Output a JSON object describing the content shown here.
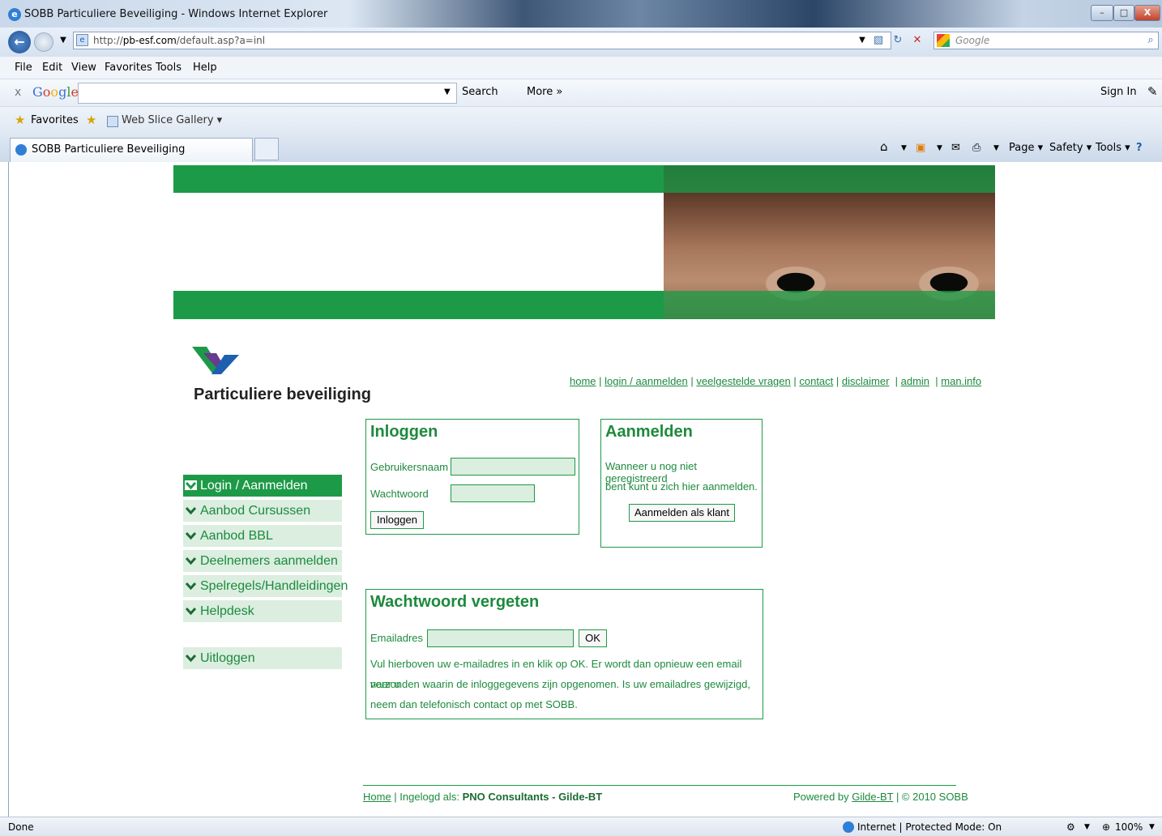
{
  "window": {
    "title": "SOBB Particuliere Beveiliging - Windows Internet Explorer",
    "min": "–",
    "max": "□",
    "close": "X"
  },
  "address": {
    "url_prefix": "http://",
    "url_domain": "pb-esf.com",
    "url_path": "/default.asp?a=inl",
    "search_placeholder": "Google"
  },
  "menu": [
    "File",
    "Edit",
    "View",
    "Favorites",
    "Tools",
    "Help"
  ],
  "google_toolbar": {
    "close": "x",
    "logo": "Google",
    "search": "Search",
    "more": "More »",
    "sign_in": "Sign In"
  },
  "favorites_bar": {
    "favorites": "Favorites",
    "web_slice": "Web Slice Gallery ▾"
  },
  "tab": {
    "title": "SOBB Particuliere Beveiliging"
  },
  "command_bar": {
    "page": "Page ▾",
    "safety": "Safety ▾",
    "tools": "Tools ▾"
  },
  "site": {
    "brand": "Particuliere beveiliging",
    "toplinks": [
      "home",
      "login / aanmelden",
      "veelgestelde vragen",
      "contact",
      "disclaimer",
      "admin",
      "man.info"
    ],
    "nav": [
      {
        "label": "Login / Aanmelden",
        "active": true
      },
      {
        "label": "Aanbod Cursussen",
        "active": false
      },
      {
        "label": "Aanbod BBL",
        "active": false
      },
      {
        "label": "Deelnemers aanmelden",
        "active": false
      },
      {
        "label": "Spelregels/Handleidingen",
        "active": false
      },
      {
        "label": "Helpdesk",
        "active": false
      }
    ],
    "logout": "Uitloggen",
    "colors": {
      "green": "#1d9a47",
      "light_green": "#dbeee0"
    }
  },
  "login": {
    "title": "Inloggen",
    "username_label": "Gebruikersnaam",
    "password_label": "Wachtwoord",
    "button": "Inloggen"
  },
  "register": {
    "title": "Aanmelden",
    "line1": "Wanneer u nog niet geregistreerd",
    "line2": "bent kunt u zich hier aanmelden.",
    "button": "Aanmelden als klant"
  },
  "forgot": {
    "title": "Wachtwoord vergeten",
    "email_label": "Emailadres",
    "ok": "OK",
    "line1": "Vul hierboven uw e-mailadres in en klik op OK. Er wordt dan opnieuw een email naar u",
    "line2": "verzonden waarin de inloggegevens zijn opgenomen. Is uw emailadres gewijzigd,",
    "line3": "neem dan telefonisch contact op met SOBB."
  },
  "footer": {
    "home": "Home",
    "logged_in_prefix": " | Ingelogd als: ",
    "logged_in_user": "PNO Consultants - Gilde-BT",
    "powered_prefix": "Powered by ",
    "powered_link": "Gilde-BT",
    "copyright": " | © 2010 SOBB"
  },
  "status": {
    "left": "Done",
    "zone": "Internet | Protected Mode: On",
    "zoom": "100%"
  }
}
